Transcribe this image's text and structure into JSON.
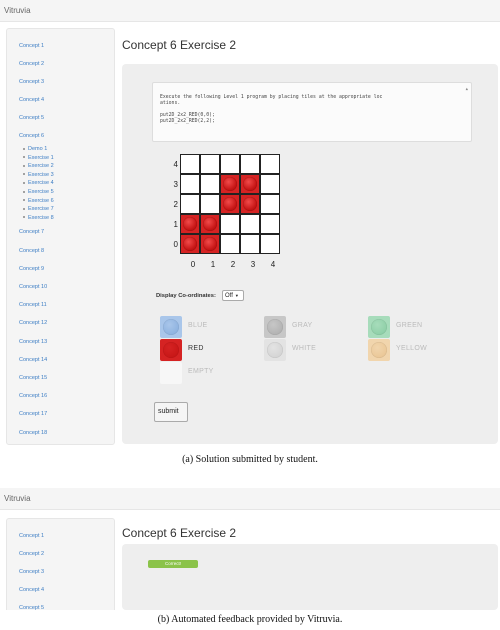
{
  "figure_a": {
    "app_title": "Vitruvia",
    "sidebar": {
      "concepts_before": [
        "Concept 1",
        "Concept 2",
        "Concept 3",
        "Concept 4",
        "Concept 5",
        "Concept 6"
      ],
      "concept6_items": [
        "Demo 1",
        "Exercise 1",
        "Exercise 2",
        "Exercise 3",
        "Exercise 4",
        "Exercise 5",
        "Exercise 6",
        "Exercise 7",
        "Exercise 8"
      ],
      "concepts_after": [
        "Concept 7",
        "Concept 8",
        "Concept 9",
        "Concept 10",
        "Concept 11",
        "Concept 12",
        "Concept 13",
        "Concept 14",
        "Concept 15",
        "Concept 16",
        "Concept 17",
        "Concept 18"
      ]
    },
    "page_title": "Concept 6 Exercise 2",
    "code": {
      "lines": [
        "Execute the following Level 1 program by placing tiles at the appropriate loc",
        "ations."
      ],
      "program": [
        "put2D_2x2_RED(0,0);",
        "put2D_2x2_RED(2,2);"
      ]
    },
    "grid": {
      "row_labels": [
        "4",
        "3",
        "2",
        "1",
        "0"
      ],
      "col_labels": [
        "0",
        "1",
        "2",
        "3",
        "4"
      ],
      "red_cells": [
        [
          0,
          0
        ],
        [
          1,
          0
        ],
        [
          0,
          1
        ],
        [
          1,
          1
        ],
        [
          2,
          2
        ],
        [
          3,
          2
        ],
        [
          2,
          3
        ],
        [
          3,
          3
        ]
      ]
    },
    "display_coordinates": {
      "label": "Display Co-ordinates:",
      "value": "Off"
    },
    "palette": [
      {
        "name": "BLUE",
        "color": "#a9c6ea",
        "knob": "#8fb3e0",
        "text_color": "#bbbbbb"
      },
      {
        "name": "GRAY",
        "color": "#c7c7c7",
        "knob": "#b3b3b3",
        "text_color": "#bbbbbb"
      },
      {
        "name": "GREEN",
        "color": "#a7dcbb",
        "knob": "#8fd0a8",
        "text_color": "#bbbbbb"
      },
      {
        "name": "RED",
        "color": "#d52323",
        "knob": "#c81717",
        "text_color": "#333333"
      },
      {
        "name": "WHITE",
        "color": "#e3e3e3",
        "knob": "#d5d5d5",
        "text_color": "#bbbbbb"
      },
      {
        "name": "YELLOW",
        "color": "#f1d5ad",
        "knob": "#ebc898",
        "text_color": "#bbbbbb"
      },
      {
        "name": "EMPTY",
        "color": "#f7f7f7",
        "knob": "#f7f7f7",
        "text_color": "#bbbbbb"
      }
    ],
    "submit_label": "submit",
    "caption": "(a) Solution submitted by student."
  },
  "figure_b": {
    "app_title": "Vitruvia",
    "sidebar": [
      "Concept 1",
      "Concept 2",
      "Concept 3",
      "Concept 4",
      "Concept 5"
    ],
    "page_title": "Concept 6 Exercise 2",
    "feedback_badge": "Correct!",
    "caption": "(b) Automated feedback provided by Vitruvia."
  }
}
